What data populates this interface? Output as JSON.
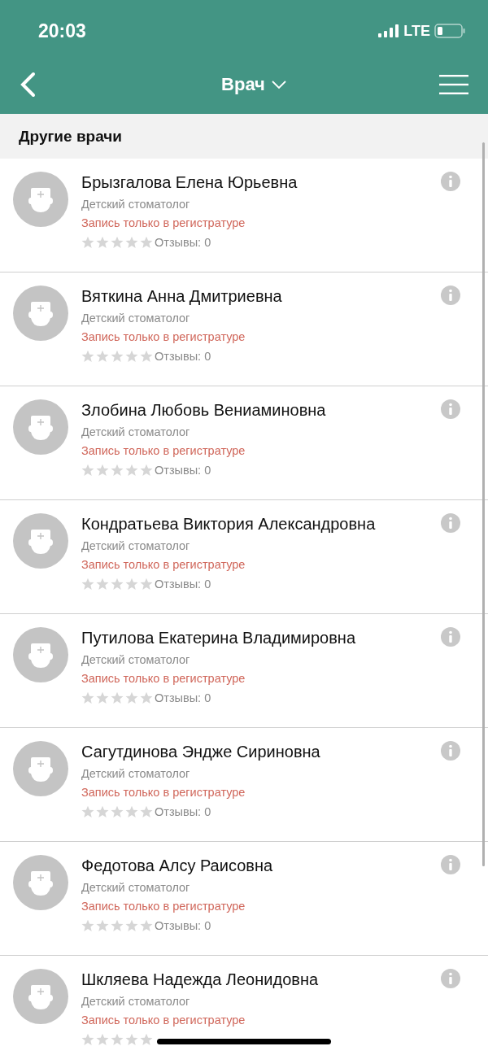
{
  "status_bar": {
    "time": "20:03",
    "network": "LTE"
  },
  "nav_bar": {
    "title": "Врач"
  },
  "section": {
    "title": "Другие врачи"
  },
  "doctors": [
    {
      "name": "Брызгалова Елена Юрьевна",
      "specialty": "Детский стоматолог",
      "note": "Запись только в регистратуре",
      "stars": 0,
      "reviews": "Отзывы: 0"
    },
    {
      "name": "Вяткина Анна Дмитриевна",
      "specialty": "Детский стоматолог",
      "note": "Запись только в регистратуре",
      "stars": 0,
      "reviews": "Отзывы: 0"
    },
    {
      "name": "Злобина Любовь Вениаминовна",
      "specialty": "Детский стоматолог",
      "note": "Запись только в регистратуре",
      "stars": 0,
      "reviews": "Отзывы: 0"
    },
    {
      "name": "Кондратьева Виктория Александровна",
      "specialty": "Детский стоматолог",
      "note": "Запись только в регистратуре",
      "stars": 0,
      "reviews": "Отзывы: 0"
    },
    {
      "name": "Путилова Екатерина Владимировна",
      "specialty": "Детский стоматолог",
      "note": "Запись только в регистратуре",
      "stars": 0,
      "reviews": "Отзывы: 0"
    },
    {
      "name": "Сагутдинова Эндже Сириновна",
      "specialty": "Детский стоматолог",
      "note": "Запись только в регистратуре",
      "stars": 0,
      "reviews": "Отзывы: 0"
    },
    {
      "name": "Федотова Алсу Раисовна",
      "specialty": "Детский стоматолог",
      "note": "Запись только в регистратуре",
      "stars": 0,
      "reviews": "Отзывы: 0"
    },
    {
      "name": "Шкляева Надежда Леонидовна",
      "specialty": "Детский стоматолог",
      "note": "Запись только в регистратуре",
      "stars": 0
    }
  ]
}
